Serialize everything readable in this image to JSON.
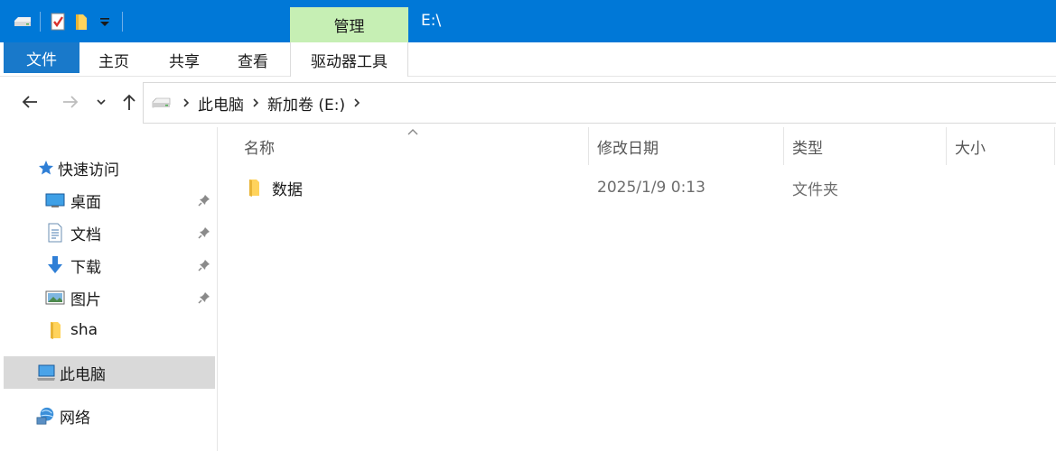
{
  "titlebar": {
    "manage_label": "管理",
    "path": "E:\\"
  },
  "ribbon": {
    "tabs": [
      "文件",
      "主页",
      "共享",
      "查看",
      "驱动器工具"
    ]
  },
  "addressbar": {
    "crumbs": [
      "此电脑",
      "新加卷 (E:)"
    ]
  },
  "navpane": {
    "quick_access": "快速访问",
    "items": [
      "桌面",
      "文档",
      "下载",
      "图片",
      "sha"
    ],
    "this_pc": "此电脑",
    "network": "网络"
  },
  "content": {
    "columns": [
      "名称",
      "修改日期",
      "类型",
      "大小"
    ],
    "rows": [
      {
        "name": "数据",
        "modified": "2025/1/9 0:13",
        "type": "文件夹",
        "size": ""
      }
    ]
  },
  "colors": {
    "titlebar": "#0078d7",
    "manage_tab": "#c6efb4",
    "file_tab": "#1979ca",
    "selected": "#d9d9d9"
  }
}
